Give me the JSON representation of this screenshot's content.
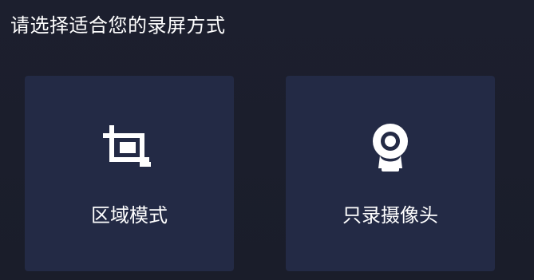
{
  "header": {
    "title": "请选择适合您的录屏方式"
  },
  "modes": [
    {
      "label": "区域模式",
      "icon": "crop-icon"
    },
    {
      "label": "只录摄像头",
      "icon": "webcam-icon"
    }
  ],
  "colors": {
    "background": "#1b1e2c",
    "card": "#232a45",
    "text": "#ffffff"
  }
}
